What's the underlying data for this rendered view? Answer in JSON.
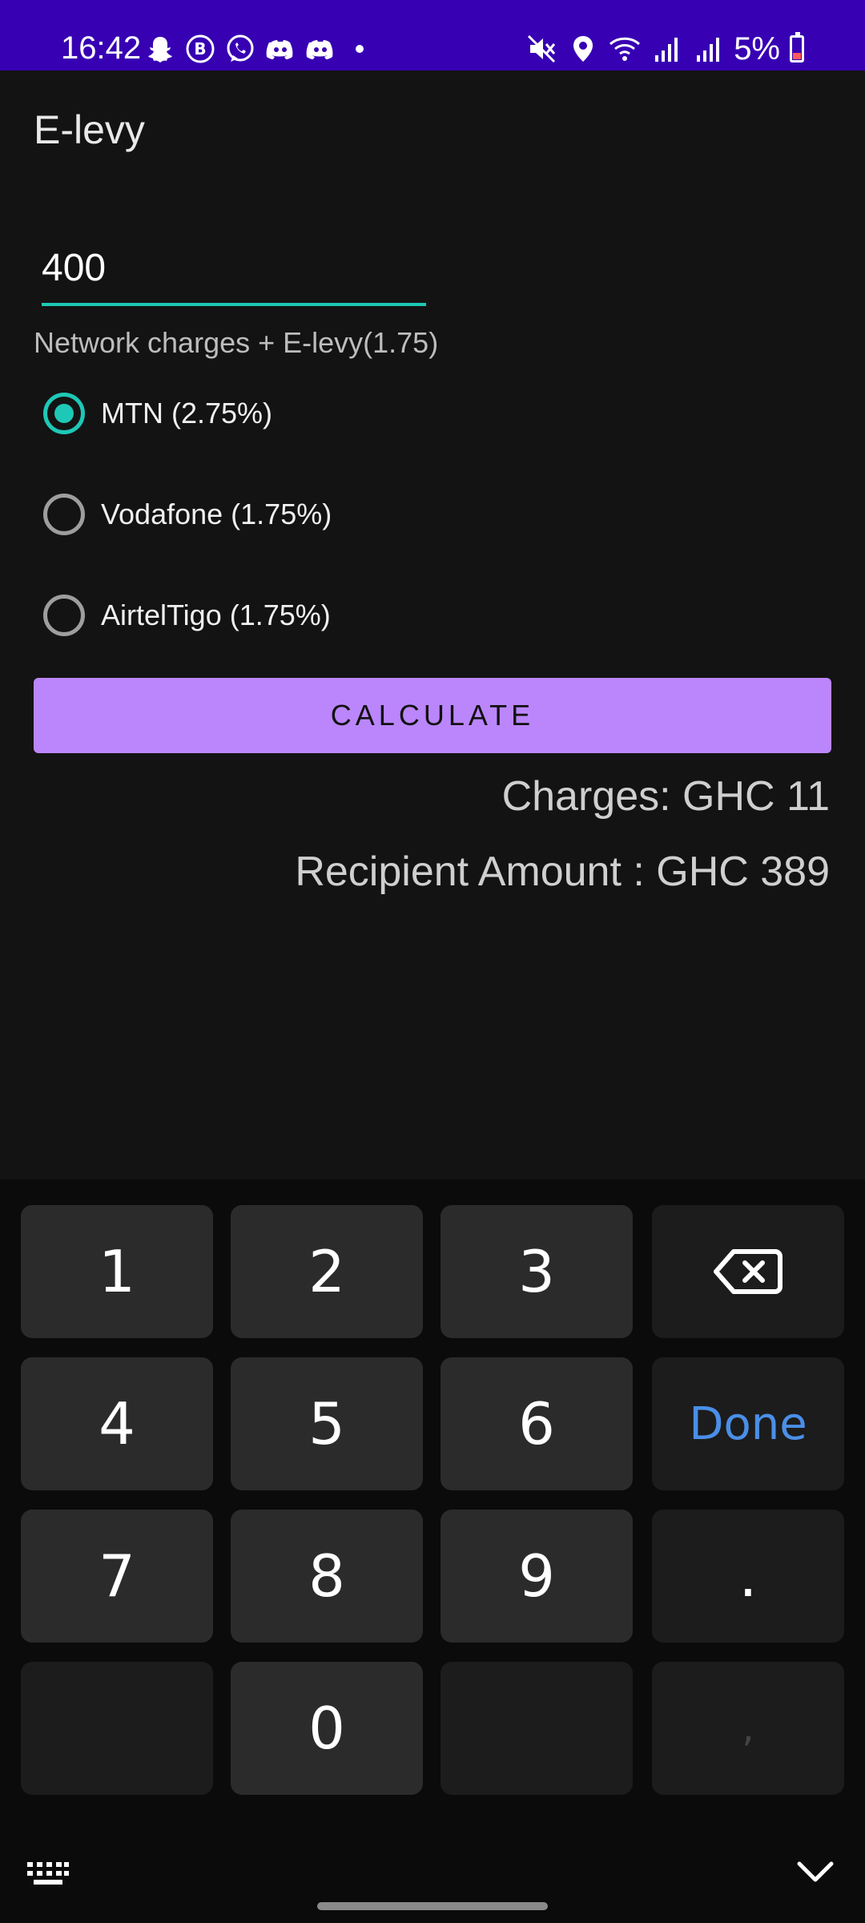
{
  "status_bar": {
    "time": "16:42",
    "battery_percent": "5%",
    "notification_icons": [
      "snapchat-icon",
      "b-icon",
      "whatsapp-icon",
      "discord-icon",
      "discord-icon",
      "dot-icon"
    ],
    "system_icons": [
      "mute-icon",
      "location-icon",
      "wifi-icon",
      "signal-icon",
      "signal-icon",
      "battery-icon"
    ],
    "colors": {
      "background": "#3700b3"
    }
  },
  "app": {
    "title": "E-levy",
    "amount_value": "400",
    "hint": "Network charges + E-levy(1.75)",
    "networks": [
      {
        "label": "MTN (2.75%)",
        "checked": true
      },
      {
        "label": "Vodafone (1.75%)",
        "checked": false
      },
      {
        "label": "AirtelTigo (1.75%)",
        "checked": false
      }
    ],
    "calculate_label": "CALCULATE",
    "charges_text": "Charges: GHC 11",
    "recipient_text": "Recipient Amount : GHC 389",
    "colors": {
      "accent": "#1ec8b6",
      "button": "#bb86fc"
    }
  },
  "keyboard": {
    "keys": {
      "k1": "1",
      "k2": "2",
      "k3": "3",
      "k4": "4",
      "k5": "5",
      "k6": "6",
      "k7": "7",
      "k8": "8",
      "k9": "9",
      "k0": "0",
      "dot": ".",
      "comma": ",",
      "done": "Done"
    },
    "icons": [
      "backspace-icon",
      "keyboard-switch-icon",
      "hide-keyboard-icon"
    ],
    "colors": {
      "done": "#4a8fe7"
    }
  }
}
